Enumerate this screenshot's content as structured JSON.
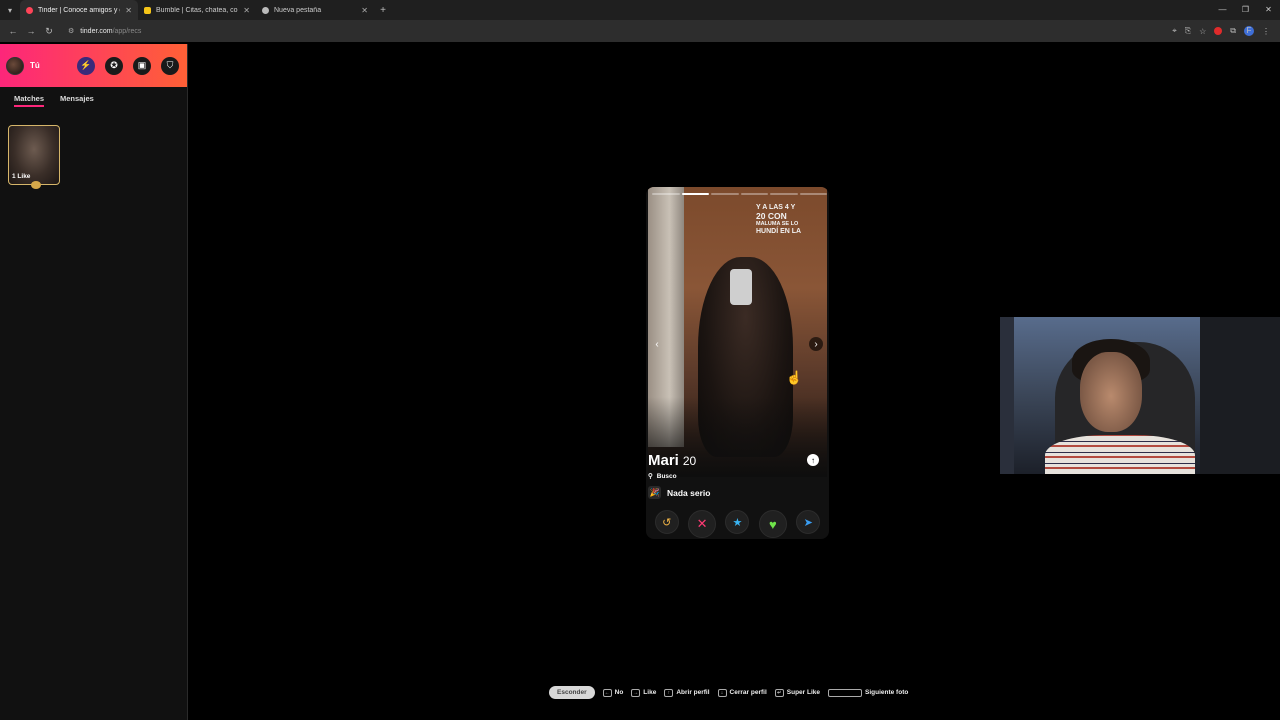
{
  "browser": {
    "tabs": [
      {
        "title": "Tinder | Conoce amigos y gente",
        "active": true,
        "favicon_color": "#ff4458"
      },
      {
        "title": "Bumble | Citas, chatea, conoce",
        "active": false,
        "favicon_color": "#f5c518"
      },
      {
        "title": "Nueva pestaña",
        "active": false,
        "favicon_color": "#bbbbbb"
      }
    ],
    "url_host": "tinder.com",
    "url_path": "/app/recs",
    "profile_initial": "F"
  },
  "sidebar": {
    "me_label": "Tú",
    "tabs": [
      "Matches",
      "Mensajes"
    ],
    "active_tab": "Matches",
    "likes_card_label": "1 Like"
  },
  "card": {
    "name": "Mari",
    "age": "20",
    "busco_label": "Busco",
    "goal": "Nada serio",
    "photo_overlay_lines": [
      "Y A LAS 4 Y",
      "20 CON",
      "MALUMA SE LO",
      "HUNDÍ EN LA"
    ],
    "photo_count": 6,
    "current_photo": 2
  },
  "hints": {
    "hide": "Esconder",
    "items": [
      "No",
      "Like",
      "Abrir perfil",
      "Cerrar perfil",
      "Super Like",
      "Siguiente foto"
    ]
  },
  "colors": {
    "brand_gradient_start": "#fd267a",
    "brand_gradient_end": "#ff6036",
    "rewind": "#f5b748",
    "nope": "#fd3a73",
    "super_like": "#3ab4f2",
    "like": "#6fe34a"
  }
}
